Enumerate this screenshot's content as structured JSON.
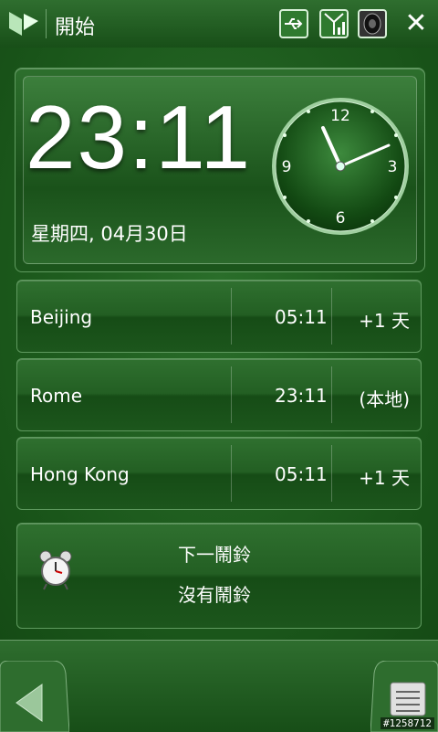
{
  "header": {
    "title": "開始",
    "close_label": "✕"
  },
  "clock": {
    "time": "23:11",
    "date": "星期四, 04月30日",
    "dial_labels": {
      "n12": "12",
      "n3": "3",
      "n6": "6",
      "n9": "9"
    }
  },
  "world_clocks": [
    {
      "city": "Beijing",
      "time": "05:11",
      "offset": "+1 天"
    },
    {
      "city": "Rome",
      "time": "23:11",
      "offset": "(本地)"
    },
    {
      "city": "Hong Kong",
      "time": "05:11",
      "offset": "+1 天"
    }
  ],
  "alarm": {
    "label": "下一鬧鈴",
    "value": "沒有鬧鈴"
  },
  "watermark": "#1258712",
  "colors": {
    "background": "#1f5a1f",
    "accent": "#5f9a5f",
    "text": "#ffffff"
  },
  "icons": [
    "start-logo-icon",
    "usb-icon",
    "signal-icon",
    "speaker-icon",
    "close-icon",
    "alarm-clock-icon",
    "back-arrow-icon",
    "menu-icon"
  ]
}
